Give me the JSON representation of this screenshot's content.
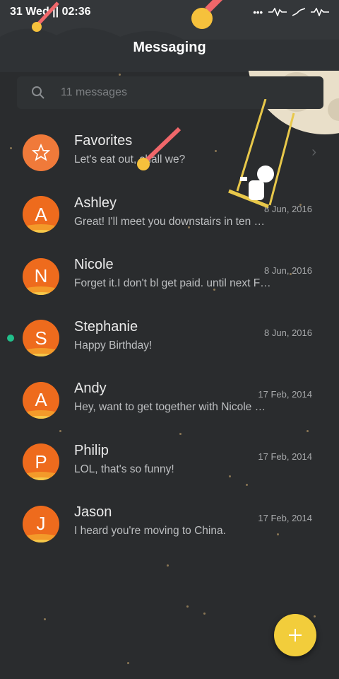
{
  "status_bar": {
    "date_time": "31 Wed || 02:36",
    "icons": [
      "more-dots",
      "signal-1",
      "signal-2",
      "signal-3"
    ]
  },
  "header": {
    "title": "Messaging"
  },
  "search": {
    "placeholder": "11 messages"
  },
  "conversations": [
    {
      "initial": "",
      "name": "Favorites",
      "preview": "Let's eat out, shall we?",
      "date": "",
      "favorite": true,
      "unread": false
    },
    {
      "initial": "A",
      "name": "Ashley",
      "preview": "Great! I'll meet you downstairs in ten …",
      "date": "8 Jun, 2016",
      "favorite": false,
      "unread": false
    },
    {
      "initial": "N",
      "name": "Nicole",
      "preview": "Forget it.I don't bl get paid. until next F…",
      "date": "8 Jun, 2016",
      "favorite": false,
      "unread": false
    },
    {
      "initial": "S",
      "name": "Stephanie",
      "preview": "Happy Birthday!",
      "date": "8 Jun, 2016",
      "favorite": false,
      "unread": true
    },
    {
      "initial": "A",
      "name": "Andy",
      "preview": "Hey, want to get together with Nicole …",
      "date": "17 Feb, 2014",
      "favorite": false,
      "unread": false
    },
    {
      "initial": "P",
      "name": "Philip",
      "preview": "LOL, that's so funny!",
      "date": "17 Feb, 2014",
      "favorite": false,
      "unread": false
    },
    {
      "initial": "J",
      "name": "Jason",
      "preview": "I heard you're moving to China.",
      "date": "17 Feb, 2014",
      "favorite": false,
      "unread": false
    }
  ],
  "fab": {
    "icon": "plus-icon"
  },
  "colors": {
    "background": "#2a2c2e",
    "accent": "#f2cd3b",
    "avatar": "#ee6b1d",
    "unread": "#21c08b"
  }
}
